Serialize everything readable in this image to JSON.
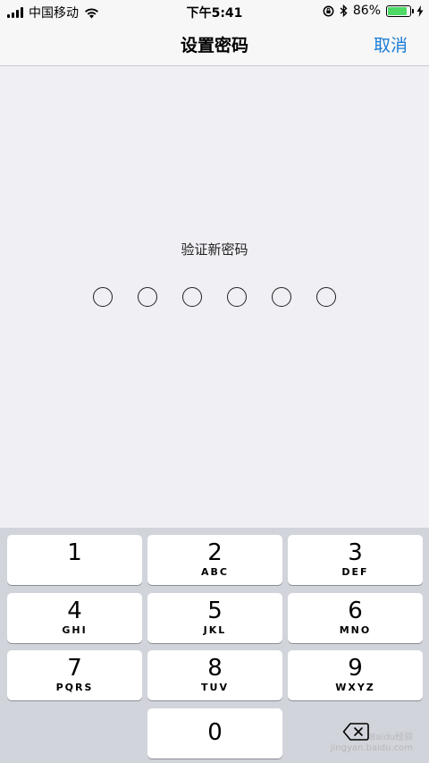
{
  "status_bar": {
    "carrier": "中国移动",
    "time": "下午5:41",
    "battery_percent": "86%",
    "battery_level": 0.86,
    "icons": [
      "signal-icon",
      "wifi-icon",
      "orientation-lock-icon",
      "bluetooth-icon",
      "battery-icon",
      "charging-icon"
    ]
  },
  "nav": {
    "title": "设置密码",
    "cancel_label": "取消",
    "accent_color": "#1a7cd6"
  },
  "passcode": {
    "prompt": "验证新密码",
    "digits_total": 6,
    "digits_entered": 0
  },
  "keypad": {
    "keys": [
      {
        "num": "1",
        "letters": ""
      },
      {
        "num": "2",
        "letters": "ABC"
      },
      {
        "num": "3",
        "letters": "DEF"
      },
      {
        "num": "4",
        "letters": "GHI"
      },
      {
        "num": "5",
        "letters": "JKL"
      },
      {
        "num": "6",
        "letters": "MNO"
      },
      {
        "num": "7",
        "letters": "PQRS"
      },
      {
        "num": "8",
        "letters": "TUV"
      },
      {
        "num": "9",
        "letters": "WXYZ"
      },
      {
        "num": "0",
        "letters": ""
      }
    ],
    "delete_icon": "delete-backspace-icon"
  },
  "watermark": {
    "line1": "Baidu经验",
    "line2": "jingyan.baidu.com"
  }
}
